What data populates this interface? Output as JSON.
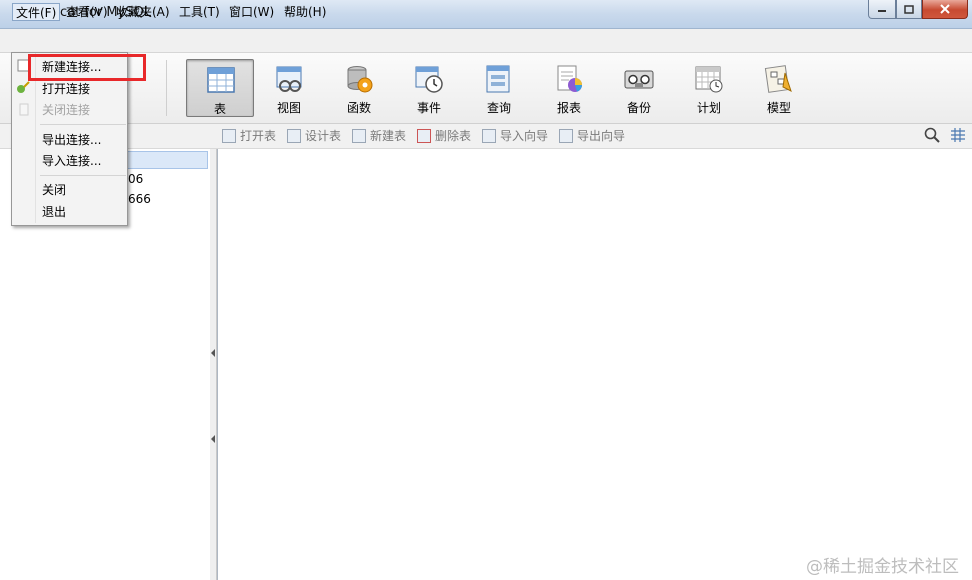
{
  "window": {
    "title": "Navicat for MySQL"
  },
  "menubar": [
    "文件(F)",
    "查看(V)",
    "收藏夹(A)",
    "工具(T)",
    "窗口(W)",
    "帮助(H)"
  ],
  "toolbar": {
    "items": [
      "表",
      "视图",
      "函数",
      "事件",
      "查询",
      "报表",
      "备份",
      "计划",
      "模型"
    ],
    "active": "表"
  },
  "subtoolbar": {
    "items": [
      "打开表",
      "设计表",
      "新建表",
      "删除表",
      "导入向导",
      "导出向导"
    ]
  },
  "tree": {
    "items": [
      "06",
      "666"
    ]
  },
  "file_menu": {
    "items": [
      {
        "label": "新建连接...",
        "enabled": true
      },
      {
        "label": "打开连接",
        "enabled": true
      },
      {
        "label": "关闭连接",
        "enabled": false
      },
      {
        "label": "导出连接...",
        "enabled": true
      },
      {
        "label": "导入连接...",
        "enabled": true
      },
      {
        "label": "关闭",
        "enabled": true
      },
      {
        "label": "退出",
        "enabled": true
      }
    ]
  },
  "colors": {
    "highlight": "#e8282a",
    "selection": "#dbe8f8"
  },
  "watermark": "@稀土掘金技术社区"
}
